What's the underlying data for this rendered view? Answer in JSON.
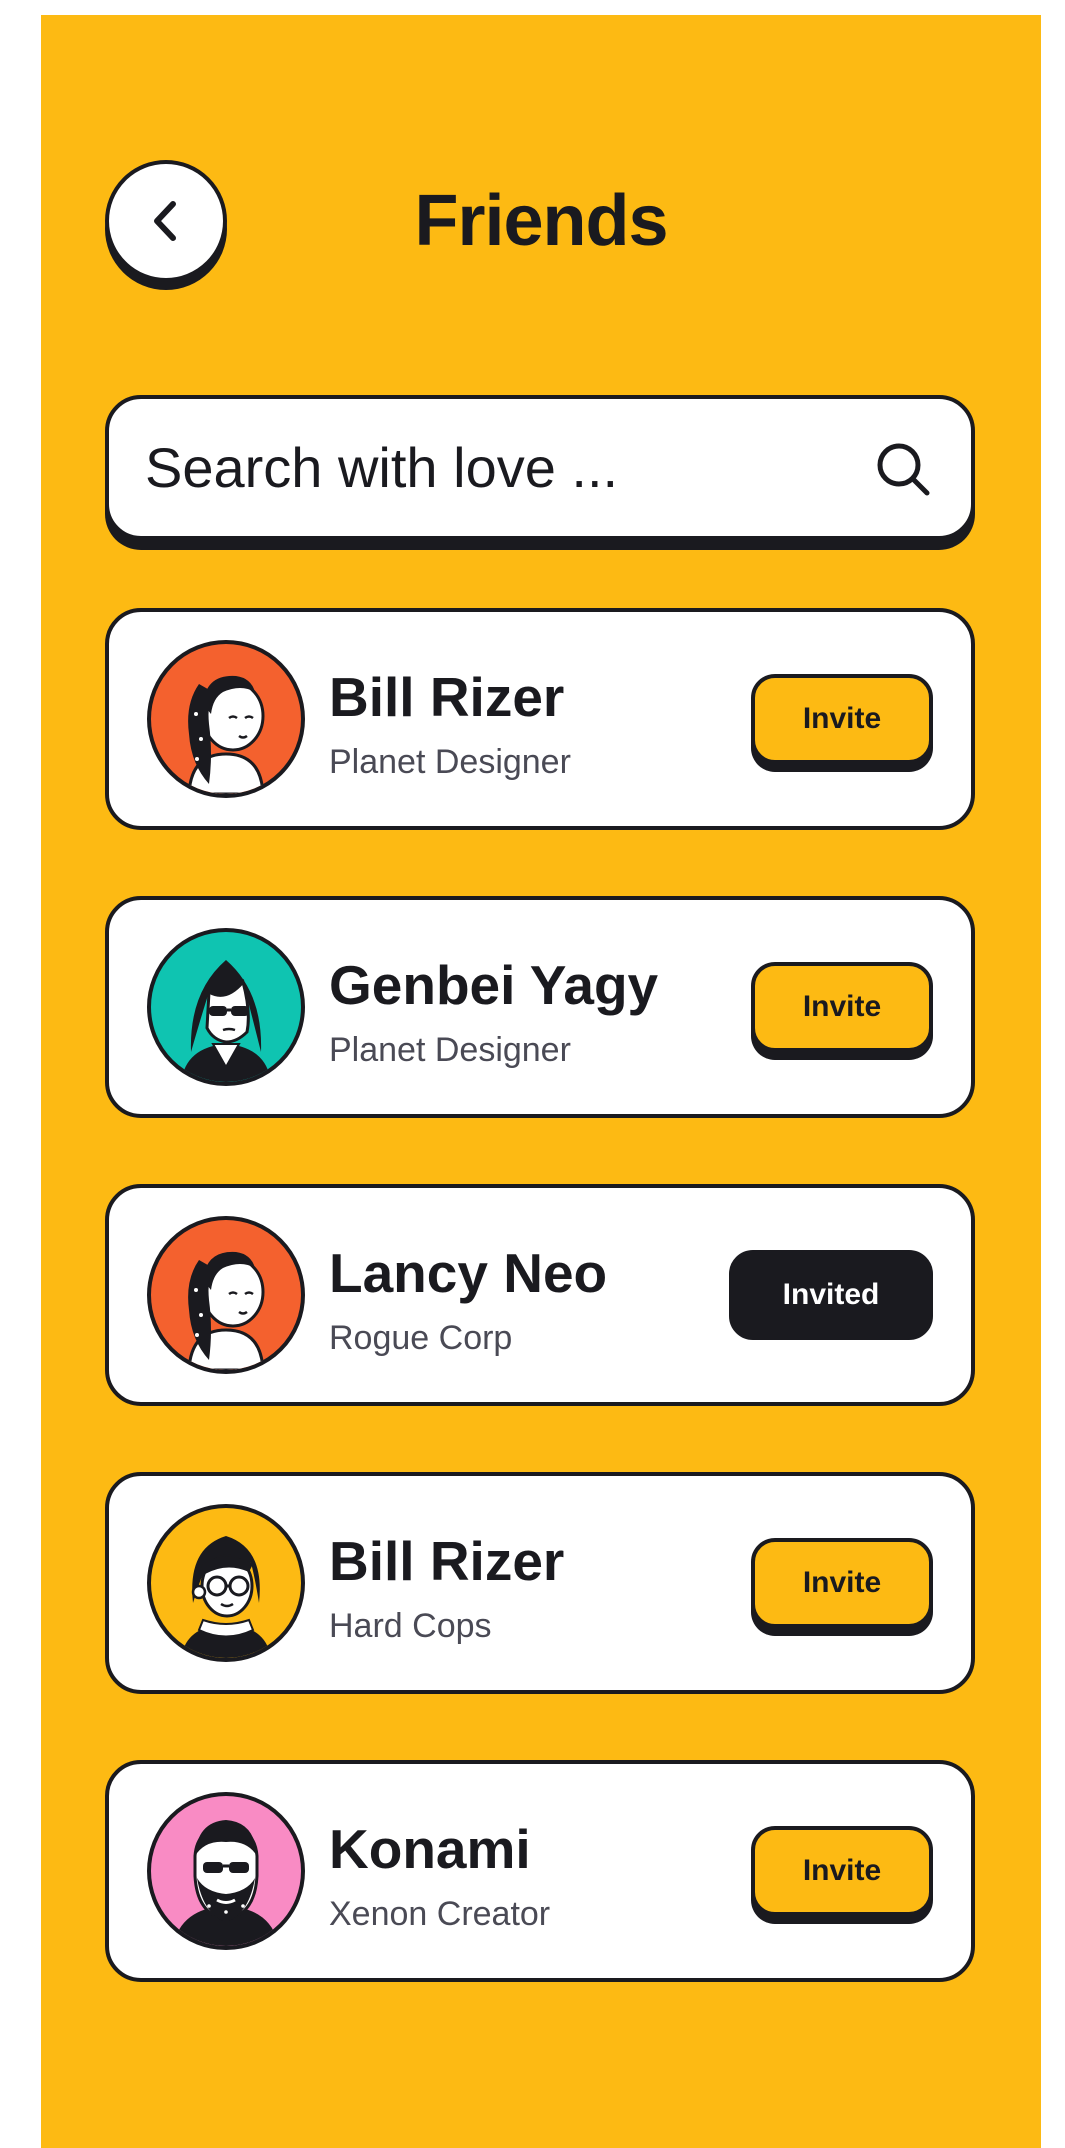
{
  "header": {
    "title": "Friends"
  },
  "search": {
    "placeholder": "Search with love ..."
  },
  "colors": {
    "background": "#FDBA13",
    "card": "#FFFFFF",
    "ink": "#1A1A1F",
    "subtext": "#4A4A55"
  },
  "friends": [
    {
      "name": "Bill Rizer",
      "role": "Planet Designer",
      "button": "Invite",
      "status": "invite",
      "avatar_bg": "#F4612E",
      "avatar_icon": "woman-ponytail-avatar"
    },
    {
      "name": "Genbei Yagy",
      "role": "Planet Designer",
      "button": "Invite",
      "status": "invite",
      "avatar_bg": "#0FC4B1",
      "avatar_icon": "woman-sunglasses-avatar"
    },
    {
      "name": "Lancy Neo",
      "role": "Rogue Corp",
      "button": "Invited",
      "status": "invited",
      "avatar_bg": "#F4612E",
      "avatar_icon": "woman-ponytail-avatar"
    },
    {
      "name": "Bill Rizer",
      "role": "Hard Cops",
      "button": "Invite",
      "status": "invite",
      "avatar_bg": "#FDBA13",
      "avatar_icon": "woman-glasses-avatar"
    },
    {
      "name": "Konami",
      "role": "Xenon Creator",
      "button": "Invite",
      "status": "invite",
      "avatar_bg": "#F98BC4",
      "avatar_icon": "man-beard-avatar"
    }
  ]
}
